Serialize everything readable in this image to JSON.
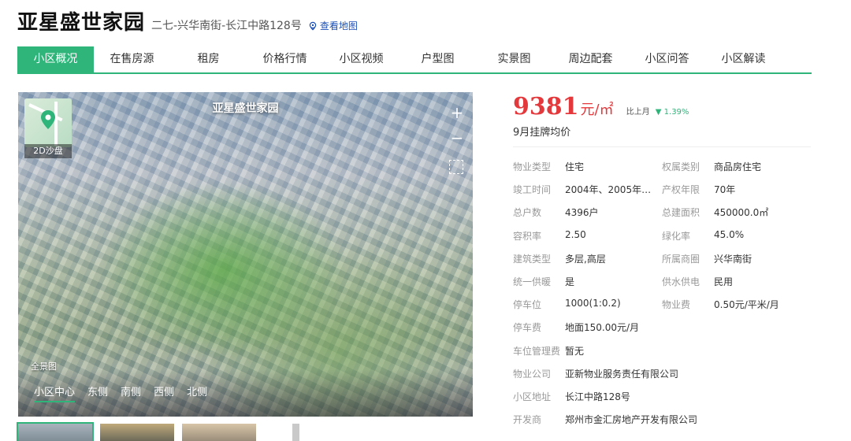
{
  "header": {
    "title": "亚星盛世家园",
    "address": "二七-兴华南街-长江中路128号",
    "map_link": "查看地图"
  },
  "tabs": [
    "小区概况",
    "在售房源",
    "租房",
    "价格行情",
    "小区视频",
    "户型图",
    "实景图",
    "周边配套",
    "小区问答",
    "小区解读"
  ],
  "media": {
    "overlay_title": "亚星盛世家园",
    "sandbox_label": "2D沙盘",
    "zoom_in": "+",
    "zoom_out": "−",
    "panorama_label": "全景图",
    "directions": [
      "小区中心",
      "东侧",
      "南侧",
      "西侧",
      "北侧"
    ]
  },
  "price": {
    "value": "9381",
    "unit": "元/㎡",
    "mom_label": "比上月",
    "mom_arrow": "▼",
    "mom_change": "1.39%",
    "subtitle": "9月挂牌均价",
    "change_color": "#2fb47a",
    "price_color": "#e4393c"
  },
  "info": [
    {
      "k1": "物业类型",
      "v1": "住宅",
      "k2": "权属类别",
      "v2": "商品房住宅"
    },
    {
      "k1": "竣工时间",
      "v1": "2004年、2005年…",
      "k2": "产权年限",
      "v2": "70年"
    },
    {
      "k1": "总户数",
      "v1": "4396户",
      "k2": "总建面积",
      "v2": "450000.0㎡"
    },
    {
      "k1": "容积率",
      "v1": "2.50",
      "k2": "绿化率",
      "v2": "45.0%"
    },
    {
      "k1": "建筑类型",
      "v1": "多层,高层",
      "k2": "所属商圈",
      "v2": "兴华南街"
    },
    {
      "k1": "统一供暖",
      "v1": "是",
      "k2": "供水供电",
      "v2": "民用"
    },
    {
      "k1": "停车位",
      "v1": "1000(1:0.2)",
      "k2": "物业费",
      "v2": "0.50元/平米/月"
    },
    {
      "k1": "停车费",
      "v1": "地面150.00元/月",
      "k2": "",
      "v2": ""
    },
    {
      "k1": "车位管理费",
      "v1": "暂无",
      "k2": "",
      "v2": ""
    },
    {
      "k1": "物业公司",
      "v1": "亚新物业服务责任有限公司",
      "k2": "",
      "v2": ""
    },
    {
      "k1": "小区地址",
      "v1": "长江中路128号",
      "k2": "",
      "v2": ""
    },
    {
      "k1": "开发商",
      "v1": "郑州市金汇房地产开发有限公司",
      "k2": "",
      "v2": ""
    }
  ],
  "accent_color": "#2fb47a"
}
